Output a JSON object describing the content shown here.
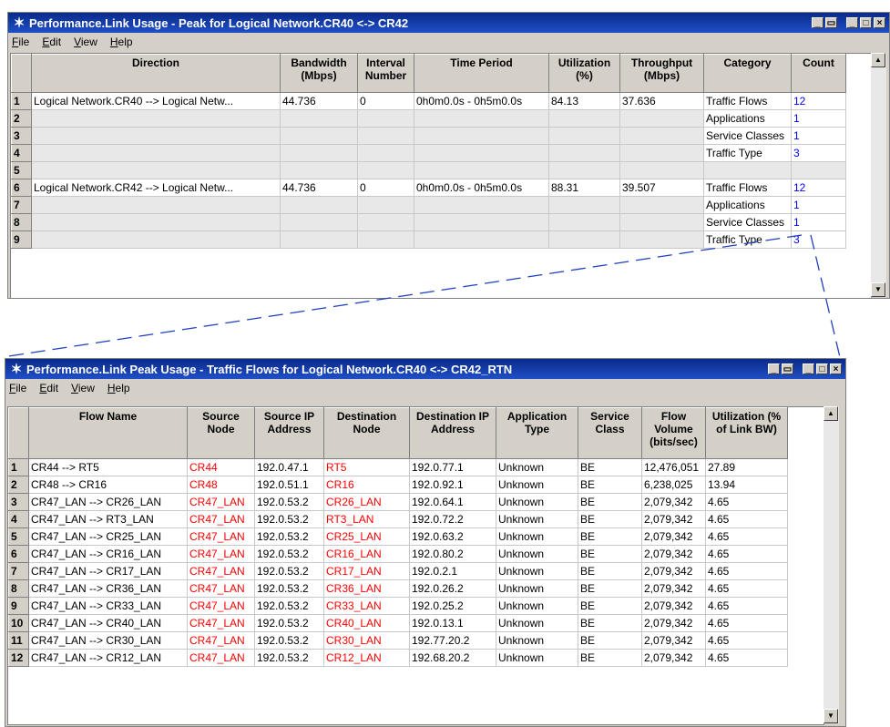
{
  "window1": {
    "title": "Performance.Link Usage - Peak for Logical Network.CR40 <-> CR42",
    "menu": [
      "File",
      "Edit",
      "View",
      "Help"
    ],
    "columns": [
      "Direction",
      "Bandwidth (Mbps)",
      "Interval Number",
      "Time Period",
      "Utilization (%)",
      "Throughput (Mbps)",
      "Category",
      "Count"
    ],
    "rows": [
      {
        "n": "1",
        "direction": "Logical Network.CR40 --> Logical Netw...",
        "bandwidth": "44.736",
        "interval": "0",
        "period": "0h0m0.0s - 0h5m0.0s",
        "util": "84.13",
        "throughput": "37.636",
        "category": "Traffic Flows",
        "count": "12"
      },
      {
        "n": "2",
        "direction": "",
        "bandwidth": "",
        "interval": "",
        "period": "",
        "util": "",
        "throughput": "",
        "category": "Applications",
        "count": "1"
      },
      {
        "n": "3",
        "direction": "",
        "bandwidth": "",
        "interval": "",
        "period": "",
        "util": "",
        "throughput": "",
        "category": "Service Classes",
        "count": "1"
      },
      {
        "n": "4",
        "direction": "",
        "bandwidth": "",
        "interval": "",
        "period": "",
        "util": "",
        "throughput": "",
        "category": "Traffic Type",
        "count": "3"
      },
      {
        "n": "5",
        "direction": "",
        "bandwidth": "",
        "interval": "",
        "period": "",
        "util": "",
        "throughput": "",
        "category": "",
        "count": ""
      },
      {
        "n": "6",
        "direction": "Logical Network.CR42 --> Logical Netw...",
        "bandwidth": "44.736",
        "interval": "0",
        "period": "0h0m0.0s - 0h5m0.0s",
        "util": "88.31",
        "throughput": "39.507",
        "category": "Traffic Flows",
        "count": "12"
      },
      {
        "n": "7",
        "direction": "",
        "bandwidth": "",
        "interval": "",
        "period": "",
        "util": "",
        "throughput": "",
        "category": "Applications",
        "count": "1"
      },
      {
        "n": "8",
        "direction": "",
        "bandwidth": "",
        "interval": "",
        "period": "",
        "util": "",
        "throughput": "",
        "category": "Service Classes",
        "count": "1"
      },
      {
        "n": "9",
        "direction": "",
        "bandwidth": "",
        "interval": "",
        "period": "",
        "util": "",
        "throughput": "",
        "category": "Traffic Type",
        "count": "3"
      }
    ]
  },
  "window2": {
    "title": "Performance.Link Peak Usage - Traffic Flows for Logical Network.CR40 <-> CR42_RTN",
    "menu": [
      "File",
      "Edit",
      "View",
      "Help"
    ],
    "columns": [
      "Flow Name",
      "Source Node",
      "Source IP Address",
      "Destination Node",
      "Destination IP Address",
      "Application Type",
      "Service Class",
      "Flow Volume (bits/sec)",
      "Utilization (% of Link BW)"
    ],
    "rows": [
      {
        "n": "1",
        "flow": "CR44 --> RT5",
        "src": "CR44",
        "srcip": "192.0.47.1",
        "dst": "RT5",
        "dstip": "192.0.77.1",
        "app": "Unknown",
        "svc": "BE",
        "vol": "12,476,051",
        "util": "27.89"
      },
      {
        "n": "2",
        "flow": "CR48 --> CR16",
        "src": "CR48",
        "srcip": "192.0.51.1",
        "dst": "CR16",
        "dstip": "192.0.92.1",
        "app": "Unknown",
        "svc": "BE",
        "vol": "6,238,025",
        "util": "13.94"
      },
      {
        "n": "3",
        "flow": "CR47_LAN --> CR26_LAN",
        "src": "CR47_LAN",
        "srcip": "192.0.53.2",
        "dst": "CR26_LAN",
        "dstip": "192.0.64.1",
        "app": "Unknown",
        "svc": "BE",
        "vol": "2,079,342",
        "util": "4.65"
      },
      {
        "n": "4",
        "flow": "CR47_LAN --> RT3_LAN",
        "src": "CR47_LAN",
        "srcip": "192.0.53.2",
        "dst": "RT3_LAN",
        "dstip": "192.0.72.2",
        "app": "Unknown",
        "svc": "BE",
        "vol": "2,079,342",
        "util": "4.65"
      },
      {
        "n": "5",
        "flow": "CR47_LAN --> CR25_LAN",
        "src": "CR47_LAN",
        "srcip": "192.0.53.2",
        "dst": "CR25_LAN",
        "dstip": "192.0.63.2",
        "app": "Unknown",
        "svc": "BE",
        "vol": "2,079,342",
        "util": "4.65"
      },
      {
        "n": "6",
        "flow": "CR47_LAN --> CR16_LAN",
        "src": "CR47_LAN",
        "srcip": "192.0.53.2",
        "dst": "CR16_LAN",
        "dstip": "192.0.80.2",
        "app": "Unknown",
        "svc": "BE",
        "vol": "2,079,342",
        "util": "4.65"
      },
      {
        "n": "7",
        "flow": "CR47_LAN --> CR17_LAN",
        "src": "CR47_LAN",
        "srcip": "192.0.53.2",
        "dst": "CR17_LAN",
        "dstip": "192.0.2.1",
        "app": "Unknown",
        "svc": "BE",
        "vol": "2,079,342",
        "util": "4.65"
      },
      {
        "n": "8",
        "flow": "CR47_LAN --> CR36_LAN",
        "src": "CR47_LAN",
        "srcip": "192.0.53.2",
        "dst": "CR36_LAN",
        "dstip": "192.0.26.2",
        "app": "Unknown",
        "svc": "BE",
        "vol": "2,079,342",
        "util": "4.65"
      },
      {
        "n": "9",
        "flow": "CR47_LAN --> CR33_LAN",
        "src": "CR47_LAN",
        "srcip": "192.0.53.2",
        "dst": "CR33_LAN",
        "dstip": "192.0.25.2",
        "app": "Unknown",
        "svc": "BE",
        "vol": "2,079,342",
        "util": "4.65"
      },
      {
        "n": "10",
        "flow": "CR47_LAN --> CR40_LAN",
        "src": "CR47_LAN",
        "srcip": "192.0.53.2",
        "dst": "CR40_LAN",
        "dstip": "192.0.13.1",
        "app": "Unknown",
        "svc": "BE",
        "vol": "2,079,342",
        "util": "4.65"
      },
      {
        "n": "11",
        "flow": "CR47_LAN --> CR30_LAN",
        "src": "CR47_LAN",
        "srcip": "192.0.53.2",
        "dst": "CR30_LAN",
        "dstip": "192.77.20.2",
        "app": "Unknown",
        "svc": "BE",
        "vol": "2,079,342",
        "util": "4.65"
      },
      {
        "n": "12",
        "flow": "CR47_LAN --> CR12_LAN",
        "src": "CR47_LAN",
        "srcip": "192.0.53.2",
        "dst": "CR12_LAN",
        "dstip": "192.68.20.2",
        "app": "Unknown",
        "svc": "BE",
        "vol": "2,079,342",
        "util": "4.65"
      }
    ]
  },
  "colors": {
    "title_bar": "#0a2a8a",
    "link_count": "#0000ff",
    "node_name": "#ff0000",
    "connector": "#1f3fbf"
  }
}
